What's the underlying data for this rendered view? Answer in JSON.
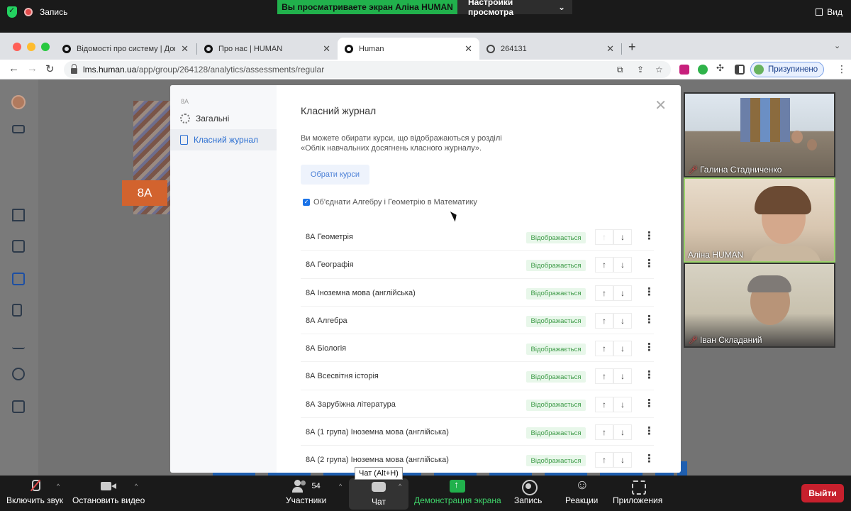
{
  "zoom_top": {
    "recording_label": "Запись",
    "share_banner": "Вы просматриваете экран Аліна HUMAN",
    "view_options": "Настройки просмотра",
    "view_label": "Вид"
  },
  "browser": {
    "tabs": [
      {
        "title": "Відомості про систему | Довід"
      },
      {
        "title": "Про нас | HUMAN"
      },
      {
        "title": "Human"
      },
      {
        "title": "264131"
      }
    ],
    "url_host": "lms.human.ua",
    "url_path": "/app/group/264128/analytics/assessments/regular",
    "profile_label": "Призупинено"
  },
  "page": {
    "class_badge": "8А"
  },
  "modal": {
    "class_name": "8А",
    "nav": [
      {
        "label": "Загальні",
        "icon": "gear-icon"
      },
      {
        "label": "Класний журнал",
        "icon": "document-icon"
      }
    ],
    "title": "Класний журнал",
    "description": "Ви можете обирати курси, що відображаються у розділі «Облік навчальних досягнень класного журналу».",
    "choose_button": "Обрати курси",
    "merge_checkbox_label": "Об'єднати Алгебру і Геометрію в Математику",
    "merge_checked": true,
    "status_label": "Відображається",
    "courses": [
      {
        "name": "8А Геометрія"
      },
      {
        "name": "8А Географія"
      },
      {
        "name": "8А Іноземна мова (англійська)"
      },
      {
        "name": "8А Алгебра"
      },
      {
        "name": "8А Біологія"
      },
      {
        "name": "8А Всесвітня історія"
      },
      {
        "name": "8А Зарубіжна література"
      },
      {
        "name": "8А (1 група) Іноземна мова (англійська)"
      },
      {
        "name": "8А (2 група) Іноземна мова (англійська)"
      }
    ]
  },
  "participants": [
    {
      "name": "Галина Стадниченко",
      "muted": true
    },
    {
      "name": "Аліна HUMAN",
      "muted": false
    },
    {
      "name": "Іван Складаний",
      "muted": true
    }
  ],
  "zoom_bottom": {
    "unmute": "Включить звук",
    "stop_video": "Остановить видео",
    "participants": "Участники",
    "participants_count": "54",
    "chat": "Чат",
    "chat_tooltip": "Чат (Alt+H)",
    "share": "Демонстрация экрана",
    "record": "Запись",
    "reactions": "Реакции",
    "apps": "Приложения",
    "leave": "Выйти"
  },
  "colors": {
    "share_green": "#21b14c",
    "accent_blue": "#2c6fd1",
    "status_green": "#3e9b48",
    "leave_red": "#c7202d"
  }
}
